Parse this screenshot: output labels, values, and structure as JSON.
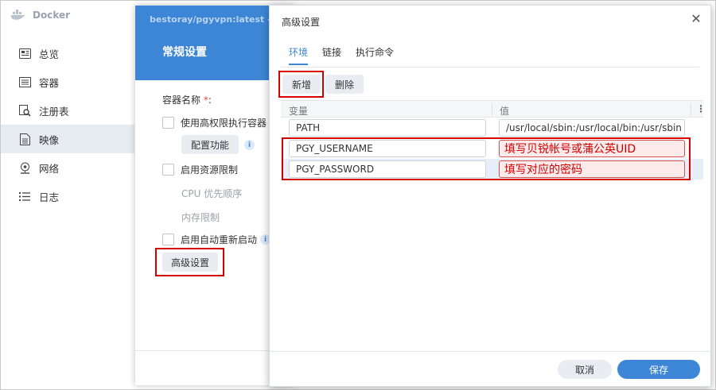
{
  "app": {
    "title": "Docker",
    "icon": "docker-whale-icon"
  },
  "sidebar": {
    "items": [
      {
        "label": "总览",
        "icon": "overview-icon"
      },
      {
        "label": "容器",
        "icon": "container-icon"
      },
      {
        "label": "注册表",
        "icon": "registry-icon"
      },
      {
        "label": "映像",
        "icon": "image-icon",
        "active": true
      },
      {
        "label": "网络",
        "icon": "network-icon"
      },
      {
        "label": "日志",
        "icon": "log-icon"
      }
    ]
  },
  "wizard": {
    "breadcrumb": "bestoray/pgyvpn:latest -",
    "title": "常规设置",
    "container_name_label": "容器名称",
    "required_mark": "*",
    "container_name_colon": ":",
    "privileged_label": "使用高权限执行容器",
    "configure_button": "配置功能",
    "resource_limit_label": "启用资源限制",
    "cpu_priority_label": "CPU 优先顺序",
    "memory_limit_label": "内存限制",
    "auto_restart_label": "启用自动重新启动",
    "advanced_button": "高级设置",
    "info_glyph": "i"
  },
  "modal": {
    "title": "高级设置",
    "close_glyph": "✕",
    "tabs": [
      {
        "label": "环境",
        "active": true
      },
      {
        "label": "链接"
      },
      {
        "label": "执行命令"
      }
    ],
    "toolbar": {
      "add_label": "新增",
      "delete_label": "删除"
    },
    "grid": {
      "columns": [
        "变量",
        "值"
      ],
      "more_glyph": "⋮",
      "rows": [
        {
          "variable": "PATH",
          "value": "/usr/local/sbin:/usr/local/bin:/usr/sbin"
        },
        {
          "variable": "PGY_USERNAME",
          "value": "填写贝锐帐号或蒲公英UID",
          "annotated": true
        },
        {
          "variable": "PGY_PASSWORD",
          "value": "填写对应的密码",
          "annotated": true,
          "selected": true
        }
      ]
    },
    "footer": {
      "cancel_label": "取消",
      "save_label": "保存"
    }
  },
  "colors": {
    "accent": "#3d86d6",
    "annotation_red": "#d20000",
    "sidebar_active": "#e7ecf3"
  }
}
